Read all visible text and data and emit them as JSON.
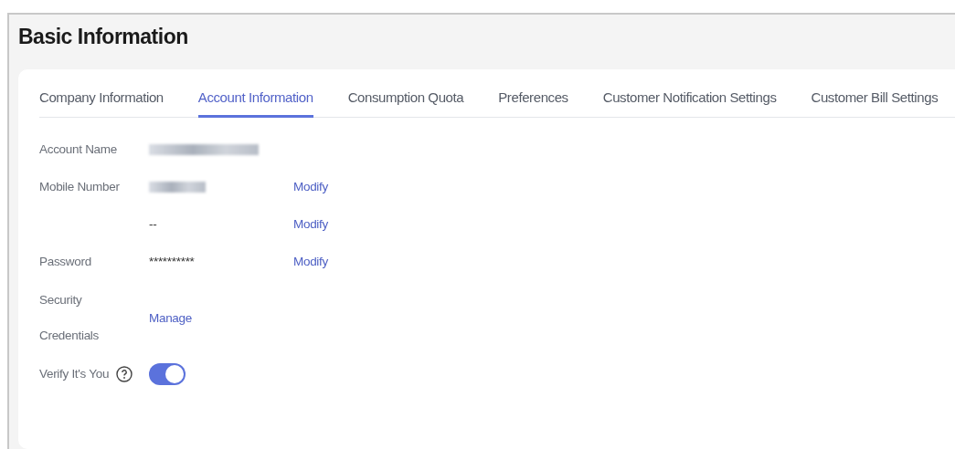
{
  "title": "Basic Information",
  "tabs": [
    {
      "label": "Company Information",
      "selected": false
    },
    {
      "label": "Account Information",
      "selected": true
    },
    {
      "label": "Consumption Quota",
      "selected": false
    },
    {
      "label": "Preferences",
      "selected": false
    },
    {
      "label": "Customer Notification Settings",
      "selected": false
    },
    {
      "label": "Customer Bill Settings",
      "selected": false
    }
  ],
  "rows": [
    {
      "kind": "redacted",
      "label": "Account Name"
    },
    {
      "kind": "redacted",
      "label": "Mobile Number",
      "action": "Modify"
    },
    {
      "kind": "text",
      "value": "--",
      "action": "Modify"
    },
    {
      "kind": "text",
      "label": "Password",
      "value": "**********",
      "action": "Modify"
    },
    {
      "kind": "link",
      "label_lines": [
        "Security",
        "Credentials"
      ],
      "link": "Manage"
    },
    {
      "kind": "toggle",
      "label": "Verify It's You",
      "on": true
    }
  ]
}
